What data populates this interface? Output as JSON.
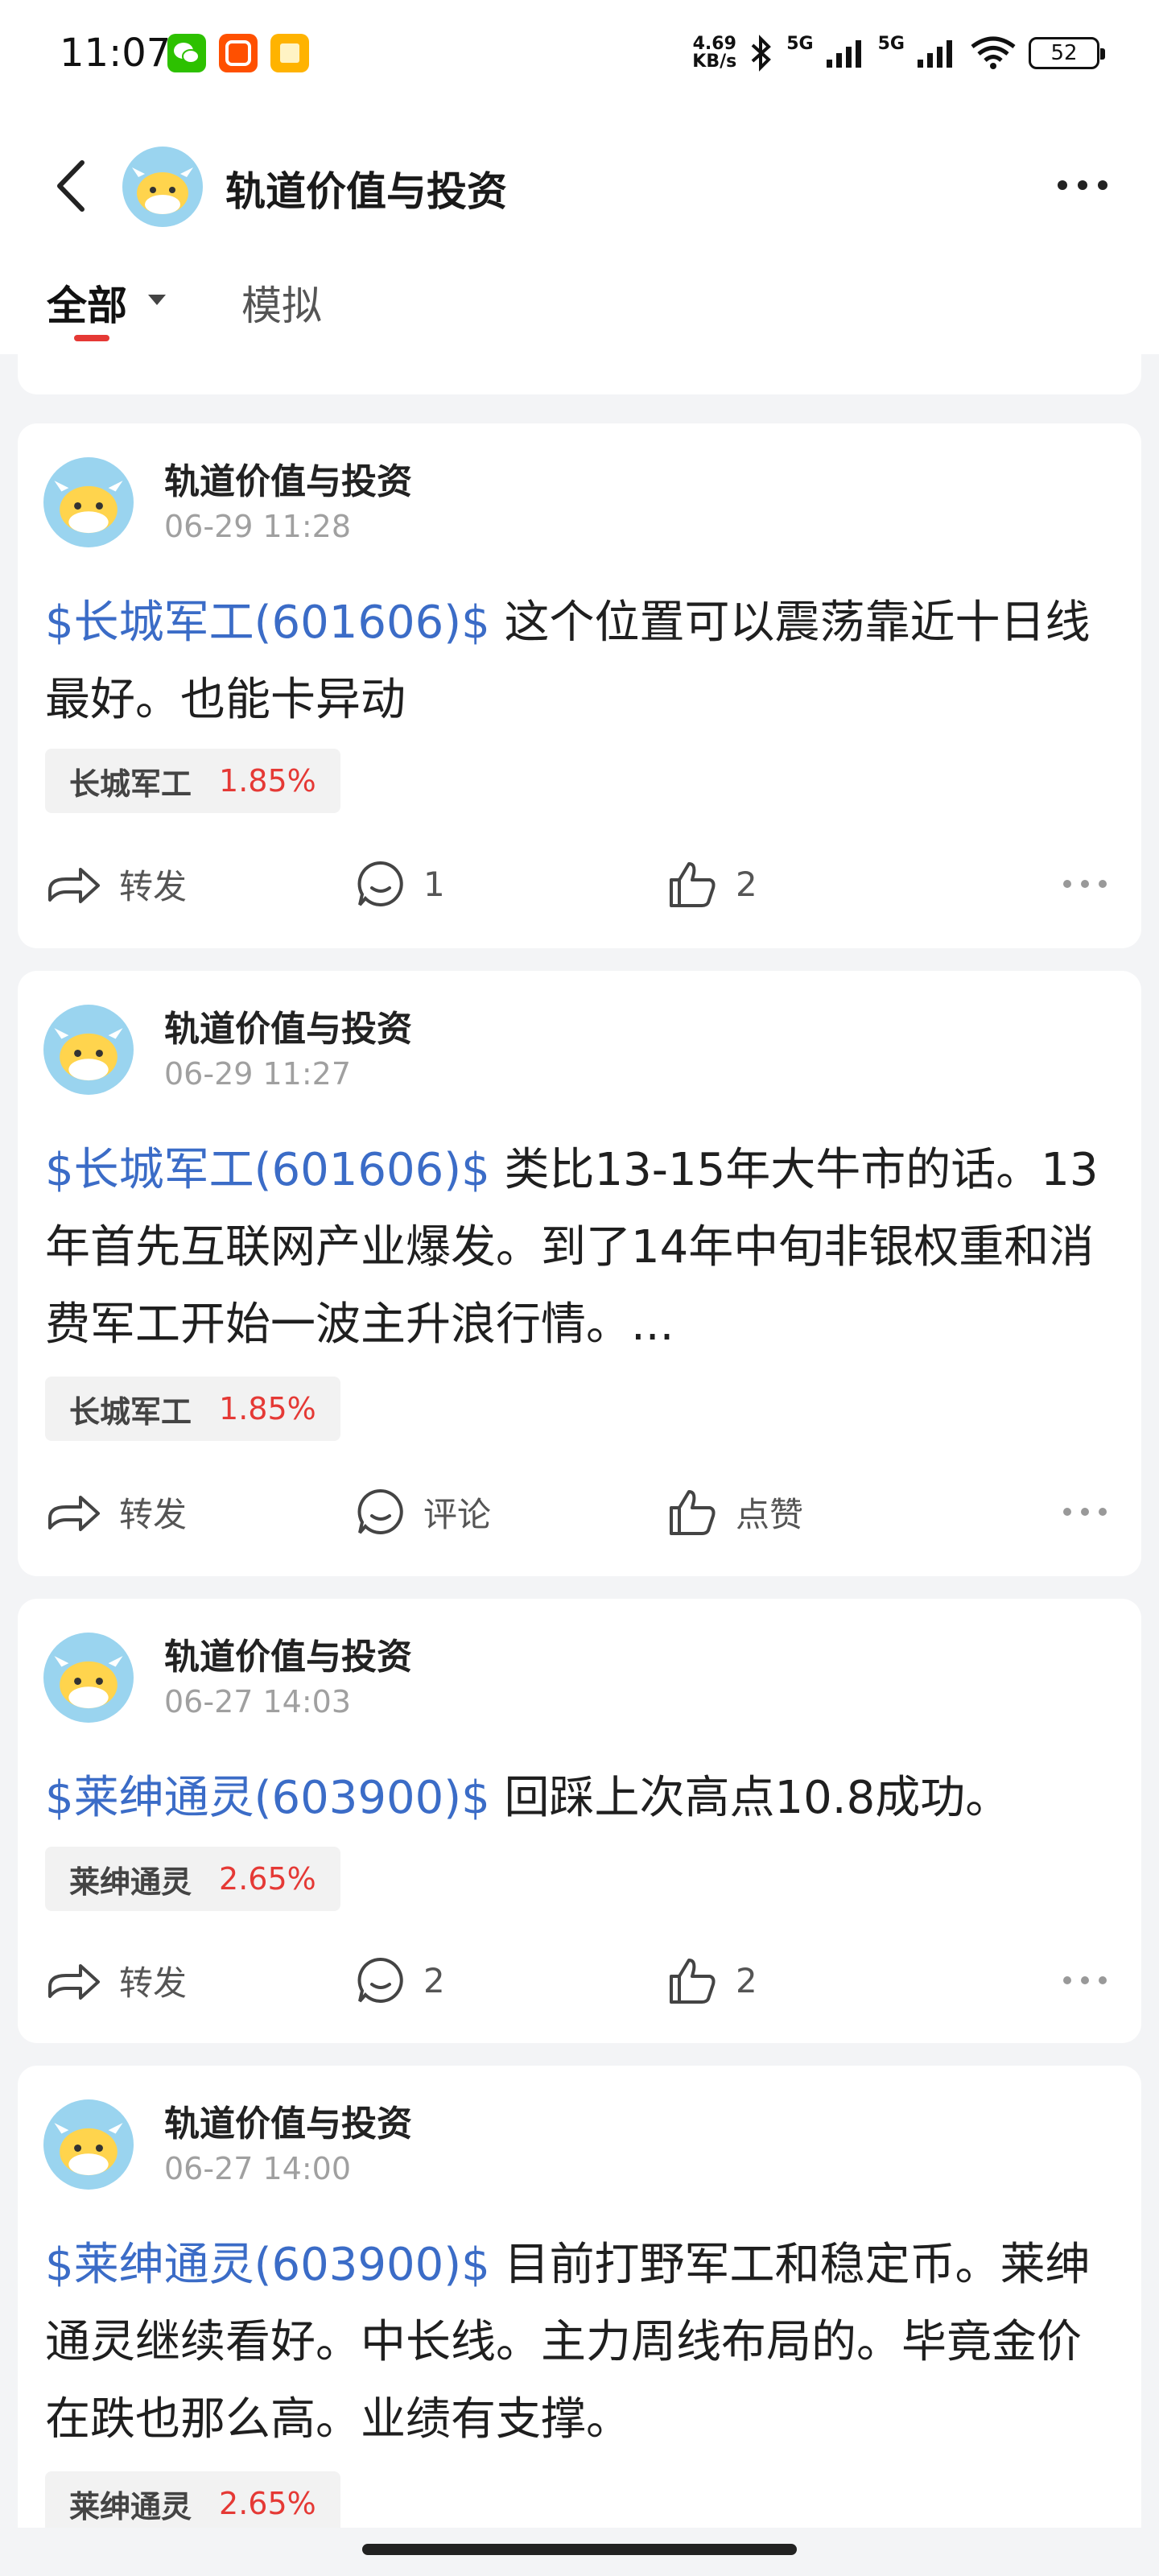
{
  "status_bar": {
    "time": "11:07",
    "net_speed_value": "4.69",
    "net_speed_unit": "KB/s",
    "signal1": "5G",
    "signal2": "5G",
    "battery": "52"
  },
  "header": {
    "title": "轨道价值与投资"
  },
  "tabs": [
    {
      "label": "全部"
    },
    {
      "label": "模拟"
    }
  ],
  "posts": [
    {
      "author": "轨道价值与投资",
      "time": "06-29 11:28",
      "link": "$长城军工(601606)$",
      "text": " 这个位置可以震荡靠近十日线最好。也能卡异动",
      "stock_name": "长城军工",
      "stock_change": "1.85%",
      "share_label": "转发",
      "comment_label": "1",
      "like_label": "2"
    },
    {
      "author": "轨道价值与投资",
      "time": "06-29 11:27",
      "link": "$长城军工(601606)$",
      "text": " 类比13-15年大牛市的话。13年首先互联网产业爆发。到了14年中旬非银权重和消费军工开始一波主升浪行情。...",
      "stock_name": "长城军工",
      "stock_change": "1.85%",
      "share_label": "转发",
      "comment_label": "评论",
      "like_label": "点赞"
    },
    {
      "author": "轨道价值与投资",
      "time": "06-27 14:03",
      "link": "$莱绅通灵(603900)$",
      "text": " 回踩上次高点10.8成功。",
      "stock_name": "莱绅通灵",
      "stock_change": "2.65%",
      "share_label": "转发",
      "comment_label": "2",
      "like_label": "2"
    },
    {
      "author": "轨道价值与投资",
      "time": "06-27 14:00",
      "link": "$莱绅通灵(603900)$",
      "text": " 目前打野军工和稳定币。莱绅通灵继续看好。中长线。主力周线布局的。毕竟金价在跌也那么高。业绩有支撑。",
      "stock_name": "莱绅通灵",
      "stock_change": "2.65%"
    }
  ],
  "colors": {
    "link": "#3b6cc7",
    "up": "#e53935",
    "background": "#f3f4f6"
  }
}
